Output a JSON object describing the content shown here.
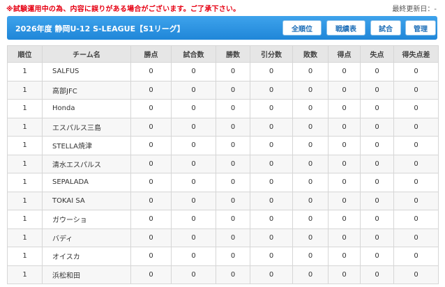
{
  "notice": "※試験運用中の為、内容に誤りがある場合がございます。ご了承下さい。",
  "last_updated": "最終更新日：-",
  "header": {
    "title": "2026年度 静岡U-12 S-LEAGUE【S1リーグ】",
    "buttons": [
      "全順位",
      "戦績表",
      "試合",
      "管理"
    ]
  },
  "table": {
    "columns": [
      "順位",
      "チーム名",
      "勝点",
      "試合数",
      "勝数",
      "引分数",
      "敗数",
      "得点",
      "失点",
      "得失点差"
    ],
    "rows": [
      [
        "1",
        "SALFUS",
        "0",
        "0",
        "0",
        "0",
        "0",
        "0",
        "0",
        "0"
      ],
      [
        "1",
        "高部JFC",
        "0",
        "0",
        "0",
        "0",
        "0",
        "0",
        "0",
        "0"
      ],
      [
        "1",
        "Honda",
        "0",
        "0",
        "0",
        "0",
        "0",
        "0",
        "0",
        "0"
      ],
      [
        "1",
        "エスパルス三島",
        "0",
        "0",
        "0",
        "0",
        "0",
        "0",
        "0",
        "0"
      ],
      [
        "1",
        "STELLA焼津",
        "0",
        "0",
        "0",
        "0",
        "0",
        "0",
        "0",
        "0"
      ],
      [
        "1",
        "清水エスパルス",
        "0",
        "0",
        "0",
        "0",
        "0",
        "0",
        "0",
        "0"
      ],
      [
        "1",
        "SEPALADA",
        "0",
        "0",
        "0",
        "0",
        "0",
        "0",
        "0",
        "0"
      ],
      [
        "1",
        "TOKAI SA",
        "0",
        "0",
        "0",
        "0",
        "0",
        "0",
        "0",
        "0"
      ],
      [
        "1",
        "ガウーショ",
        "0",
        "0",
        "0",
        "0",
        "0",
        "0",
        "0",
        "0"
      ],
      [
        "1",
        "バディ",
        "0",
        "0",
        "0",
        "0",
        "0",
        "0",
        "0",
        "0"
      ],
      [
        "1",
        "オイスカ",
        "0",
        "0",
        "0",
        "0",
        "0",
        "0",
        "0",
        "0"
      ],
      [
        "1",
        "浜松和田",
        "0",
        "0",
        "0",
        "0",
        "0",
        "0",
        "0",
        "0"
      ]
    ]
  },
  "colors": {
    "notice": "#e60012",
    "header_bg": "#2a93e0",
    "button_text": "#1f6fb8",
    "table_header_bg": "#e6e6e6"
  }
}
